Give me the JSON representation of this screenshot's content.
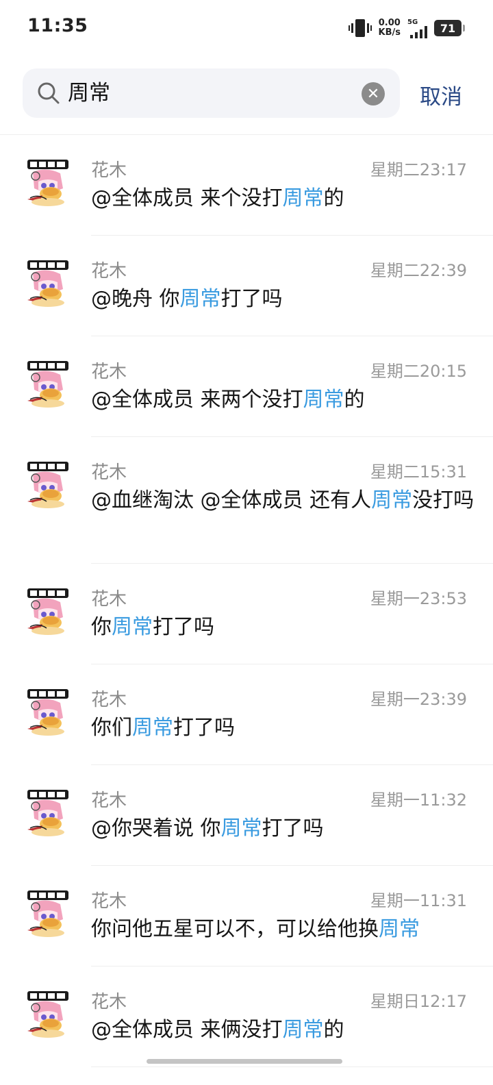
{
  "status_bar": {
    "time": "11:35",
    "net_speed": "0.00",
    "net_unit": "KB/s",
    "network": "5G",
    "battery": "71"
  },
  "search": {
    "query": "周常",
    "cancel_label": "取消"
  },
  "colors": {
    "highlight": "#3a9be0",
    "cancel": "#2b4a86"
  },
  "results": [
    {
      "sender": "花木",
      "time": "星期二23:17",
      "pre": "@全体成员  来个没打",
      "hl": "周常",
      "post": "的"
    },
    {
      "sender": "花木",
      "time": "星期二22:39",
      "pre": "@晚舟  你",
      "hl": "周常",
      "post": "打了吗"
    },
    {
      "sender": "花木",
      "time": "星期二20:15",
      "pre": "@全体成员  来两个没打",
      "hl": "周常",
      "post": "的"
    },
    {
      "sender": "花木",
      "time": "星期二15:31",
      "pre": "@血继淘汰  @全体成员  还有人",
      "hl": "周常",
      "post": "没打吗"
    },
    {
      "sender": "花木",
      "time": "星期一23:53",
      "pre": "你",
      "hl": "周常",
      "post": "打了吗"
    },
    {
      "sender": "花木",
      "time": "星期一23:39",
      "pre": "你们",
      "hl": "周常",
      "post": "打了吗"
    },
    {
      "sender": "花木",
      "time": "星期一11:32",
      "pre": "@你哭着说  你",
      "hl": "周常",
      "post": "打了吗"
    },
    {
      "sender": "花木",
      "time": "星期一11:31",
      "pre": "你问他五星可以不，可以给他换",
      "hl": "周常",
      "post": ""
    },
    {
      "sender": "花木",
      "time": "星期日12:17",
      "pre": "@全体成员  来俩没打",
      "hl": "周常",
      "post": "的"
    }
  ]
}
